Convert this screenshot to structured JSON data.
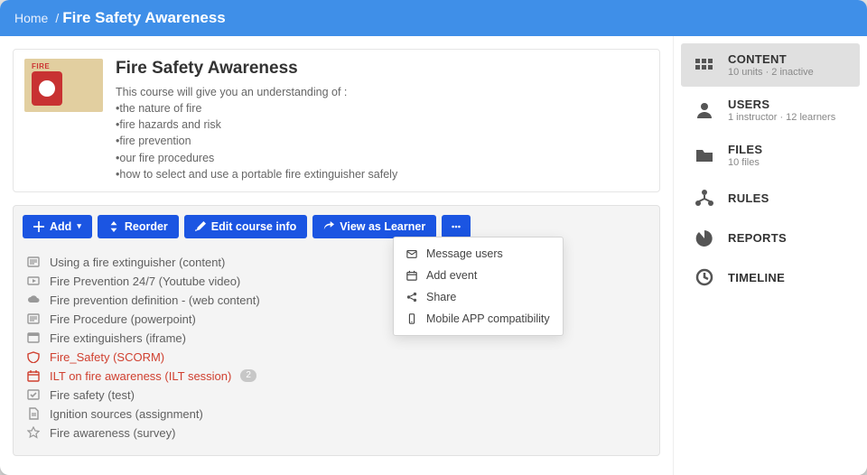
{
  "breadcrumb": {
    "home": "Home",
    "title": "Fire Safety Awareness"
  },
  "course": {
    "title": "Fire Safety Awareness",
    "intro": "This course will give you an understanding of :",
    "bullets": [
      "the nature of fire",
      "fire hazards and risk",
      "fire prevention",
      "our fire procedures",
      "how to select and use a portable fire extinguisher safely"
    ],
    "thumb_label": "FIRE"
  },
  "toolbar": {
    "add": "Add",
    "reorder": "Reorder",
    "edit": "Edit course info",
    "view_learner": "View as Learner"
  },
  "more_menu": {
    "message": "Message users",
    "event": "Add event",
    "share": "Share",
    "mobile": "Mobile APP compatibility"
  },
  "units": [
    {
      "icon": "text",
      "label": "Using a fire extinguisher (content)",
      "warn": false
    },
    {
      "icon": "video",
      "label": "Fire Prevention 24/7 (Youtube video)",
      "warn": false
    },
    {
      "icon": "cloud",
      "label": "Fire prevention definition - (web content)",
      "warn": false
    },
    {
      "icon": "text",
      "label": "Fire Procedure (powerpoint)",
      "warn": false
    },
    {
      "icon": "iframe",
      "label": "Fire extinguishers (iframe)",
      "warn": false
    },
    {
      "icon": "scorm",
      "label": "Fire_Safety (SCORM)",
      "warn": true
    },
    {
      "icon": "calendar",
      "label": "ILT on fire awareness (ILT session)",
      "warn": true,
      "badge": "2"
    },
    {
      "icon": "check",
      "label": "Fire safety (test)",
      "warn": false
    },
    {
      "icon": "doc",
      "label": "Ignition sources (assignment)",
      "warn": false
    },
    {
      "icon": "star",
      "label": "Fire awareness (survey)",
      "warn": false
    }
  ],
  "side": [
    {
      "key": "content",
      "title": "CONTENT",
      "sub": "10 units · 2 inactive",
      "active": true
    },
    {
      "key": "users",
      "title": "USERS",
      "sub": "1 instructor · 12 learners"
    },
    {
      "key": "files",
      "title": "FILES",
      "sub": "10 files"
    },
    {
      "key": "rules",
      "title": "RULES",
      "sub": ""
    },
    {
      "key": "reports",
      "title": "REPORTS",
      "sub": ""
    },
    {
      "key": "timeline",
      "title": "TIMELINE",
      "sub": ""
    }
  ]
}
